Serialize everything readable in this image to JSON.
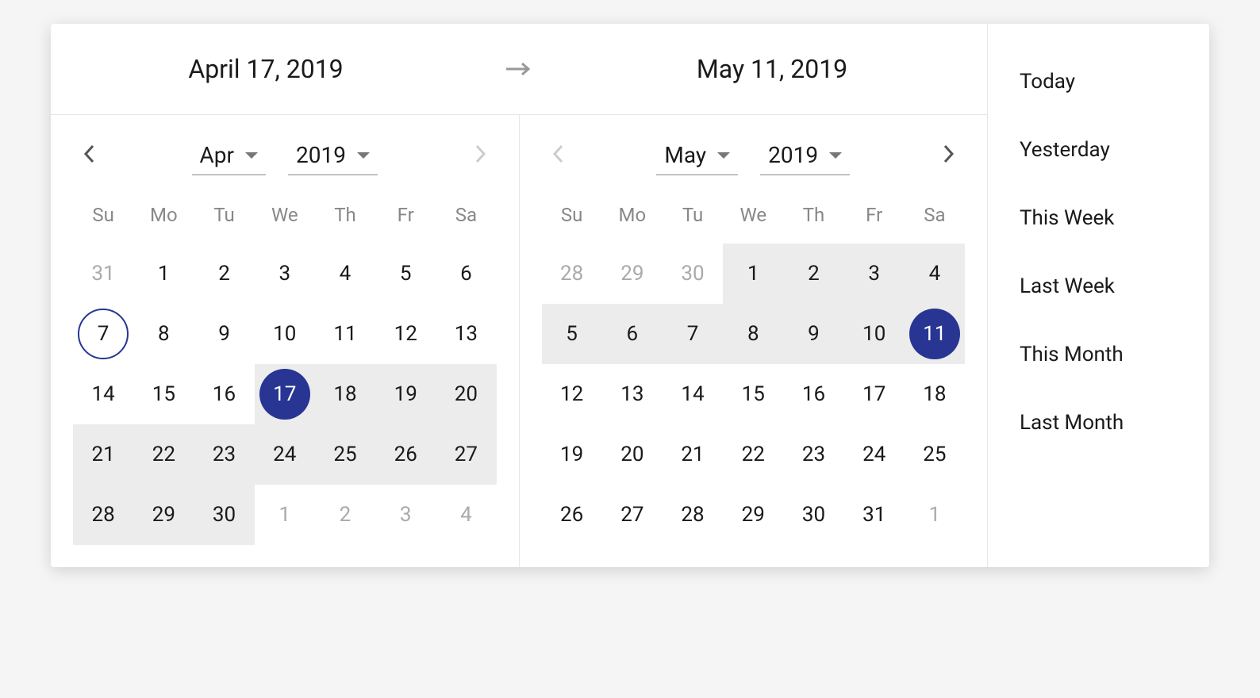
{
  "header": {
    "start_date": "April 17, 2019",
    "end_date": "May 11, 2019"
  },
  "dow": [
    "Su",
    "Mo",
    "Tu",
    "We",
    "Th",
    "Fr",
    "Sa"
  ],
  "calendars": [
    {
      "id": "start",
      "month_label": "Apr",
      "year_label": "2019",
      "prev_enabled": true,
      "next_enabled": false,
      "weeks": [
        [
          {
            "d": "31",
            "other": true
          },
          {
            "d": "1"
          },
          {
            "d": "2"
          },
          {
            "d": "3"
          },
          {
            "d": "4"
          },
          {
            "d": "5"
          },
          {
            "d": "6"
          }
        ],
        [
          {
            "d": "7",
            "today": true
          },
          {
            "d": "8"
          },
          {
            "d": "9"
          },
          {
            "d": "10"
          },
          {
            "d": "11"
          },
          {
            "d": "12"
          },
          {
            "d": "13"
          }
        ],
        [
          {
            "d": "14"
          },
          {
            "d": "15"
          },
          {
            "d": "16"
          },
          {
            "d": "17",
            "selected": true,
            "in_range": true
          },
          {
            "d": "18",
            "in_range": true
          },
          {
            "d": "19",
            "in_range": true
          },
          {
            "d": "20",
            "in_range": true
          }
        ],
        [
          {
            "d": "21",
            "in_range": true
          },
          {
            "d": "22",
            "in_range": true
          },
          {
            "d": "23",
            "in_range": true
          },
          {
            "d": "24",
            "in_range": true
          },
          {
            "d": "25",
            "in_range": true
          },
          {
            "d": "26",
            "in_range": true
          },
          {
            "d": "27",
            "in_range": true
          }
        ],
        [
          {
            "d": "28",
            "in_range": true
          },
          {
            "d": "29",
            "in_range": true
          },
          {
            "d": "30",
            "in_range": true
          },
          {
            "d": "1",
            "other": true
          },
          {
            "d": "2",
            "other": true
          },
          {
            "d": "3",
            "other": true
          },
          {
            "d": "4",
            "other": true
          }
        ]
      ]
    },
    {
      "id": "end",
      "month_label": "May",
      "year_label": "2019",
      "prev_enabled": false,
      "next_enabled": true,
      "weeks": [
        [
          {
            "d": "28",
            "other": true
          },
          {
            "d": "29",
            "other": true
          },
          {
            "d": "30",
            "other": true
          },
          {
            "d": "1",
            "in_range": true
          },
          {
            "d": "2",
            "in_range": true
          },
          {
            "d": "3",
            "in_range": true
          },
          {
            "d": "4",
            "in_range": true
          }
        ],
        [
          {
            "d": "5",
            "in_range": true
          },
          {
            "d": "6",
            "in_range": true
          },
          {
            "d": "7",
            "in_range": true
          },
          {
            "d": "8",
            "in_range": true
          },
          {
            "d": "9",
            "in_range": true
          },
          {
            "d": "10",
            "in_range": true
          },
          {
            "d": "11",
            "selected": true,
            "in_range": true
          }
        ],
        [
          {
            "d": "12"
          },
          {
            "d": "13"
          },
          {
            "d": "14"
          },
          {
            "d": "15"
          },
          {
            "d": "16"
          },
          {
            "d": "17"
          },
          {
            "d": "18"
          }
        ],
        [
          {
            "d": "19"
          },
          {
            "d": "20"
          },
          {
            "d": "21"
          },
          {
            "d": "22"
          },
          {
            "d": "23"
          },
          {
            "d": "24"
          },
          {
            "d": "25"
          }
        ],
        [
          {
            "d": "26"
          },
          {
            "d": "27"
          },
          {
            "d": "28"
          },
          {
            "d": "29"
          },
          {
            "d": "30"
          },
          {
            "d": "31"
          },
          {
            "d": "1",
            "other": true
          }
        ]
      ]
    }
  ],
  "presets": [
    "Today",
    "Yesterday",
    "This Week",
    "Last Week",
    "This Month",
    "Last Month"
  ]
}
